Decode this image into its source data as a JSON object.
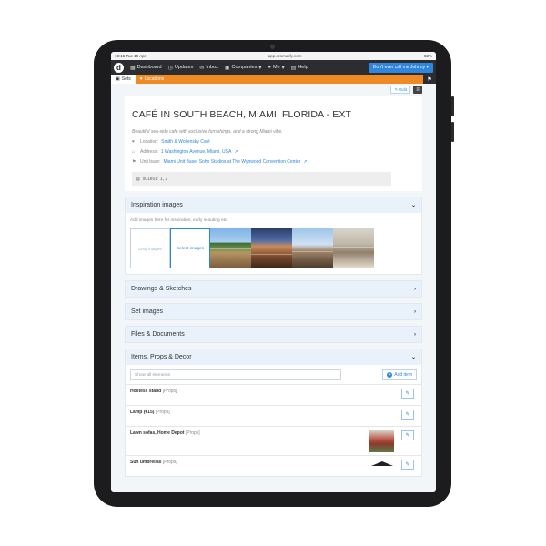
{
  "status": {
    "time": "10:15",
    "date": "Tue 19 Apr",
    "url": "app.dramatify.com",
    "battery": "82%"
  },
  "navbar": {
    "logo": "d",
    "items": [
      {
        "label": "Dashboard",
        "icon": "dashboard-icon"
      },
      {
        "label": "Updates",
        "icon": "updates-icon"
      },
      {
        "label": "Inbox",
        "icon": "inbox-icon"
      },
      {
        "label": "Companies",
        "icon": "companies-icon"
      },
      {
        "label": "Me",
        "icon": "user-icon"
      },
      {
        "label": "Help",
        "icon": "help-icon"
      }
    ],
    "call_button": "Don't ever call me Johnny"
  },
  "tabs": {
    "sets": "Sets",
    "locations": "Locations"
  },
  "toolbar": {
    "edit": "Edit"
  },
  "set": {
    "title": "CAFÉ IN SOUTH BEACH, MIAMI, FLORIDA - EXT",
    "description": "Beautiful sea-side cafe with exclusive furnishings, and a strong Miami vibe.",
    "location_label": "Location:",
    "location_value": "Smith & Wollensky Café",
    "address_label": "Address:",
    "address_value": "1 Washington Avenue, Miami, USA",
    "unit_label": "Unit base:",
    "unit_value": "Miami Unit Base, Soho Studios at The Wynwood Convention Center",
    "scenes": "s01e01: 1, 2"
  },
  "panels": {
    "inspiration": {
      "title": "Inspiration images",
      "hint": "Add images here for inspiration, early scouting etc.",
      "drop": "Drop images",
      "select": "Select images"
    },
    "drawings": {
      "title": "Drawings & Sketches"
    },
    "set_images": {
      "title": "Set images"
    },
    "files": {
      "title": "Files & Documents"
    },
    "items": {
      "title": "Items, Props & Decor",
      "search_placeholder": "Show all elements",
      "add_item": "Add item",
      "rows": [
        {
          "name": "Hostess stand",
          "category": "[Props]"
        },
        {
          "name": "Lamp (€15)",
          "category": "[Props]"
        },
        {
          "name": "Lawn sofas, Home Depot",
          "category": "[Props]"
        },
        {
          "name": "Sun umbrellas",
          "category": "[Props]"
        }
      ]
    }
  }
}
